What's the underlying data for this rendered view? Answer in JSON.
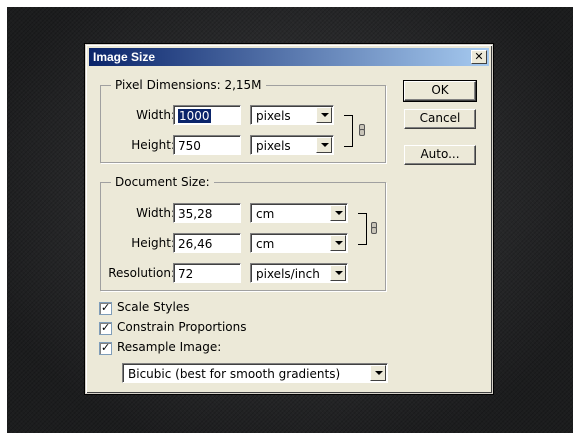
{
  "dialog": {
    "title": "Image Size",
    "close_glyph": "✕"
  },
  "pixel_dimensions": {
    "legend": "Pixel Dimensions:  2,15M",
    "width_label": "Width:",
    "width_value": "1000",
    "width_unit": "pixels",
    "height_label": "Height:",
    "height_value": "750",
    "height_unit": "pixels"
  },
  "document_size": {
    "legend": "Document Size:",
    "width_label": "Width:",
    "width_value": "35,28",
    "width_unit": "cm",
    "height_label": "Height:",
    "height_value": "26,46",
    "height_unit": "cm",
    "resolution_label": "Resolution:",
    "resolution_value": "72",
    "resolution_unit": "pixels/inch"
  },
  "buttons": {
    "ok": "OK",
    "cancel": "Cancel",
    "auto": "Auto..."
  },
  "options": {
    "scale_styles": {
      "label": "Scale Styles",
      "checked": true
    },
    "constrain_proportions": {
      "label": "Constrain Proportions",
      "checked": true
    },
    "resample_image": {
      "label": "Resample Image:",
      "checked": true
    },
    "tick_glyph": "✓"
  },
  "resample_method": "Bicubic (best for smooth gradients)",
  "colors": {
    "title_gradient_start": "#0a246a",
    "title_gradient_end": "#a6caf0",
    "dialog_face": "#ece9d8",
    "selection": "#0a246a",
    "background": "#2b2c2e"
  },
  "icons": {
    "close": "close-icon",
    "dropdown": "chevron-down-icon",
    "link": "chain-link-icon",
    "check": "checkmark-icon"
  }
}
